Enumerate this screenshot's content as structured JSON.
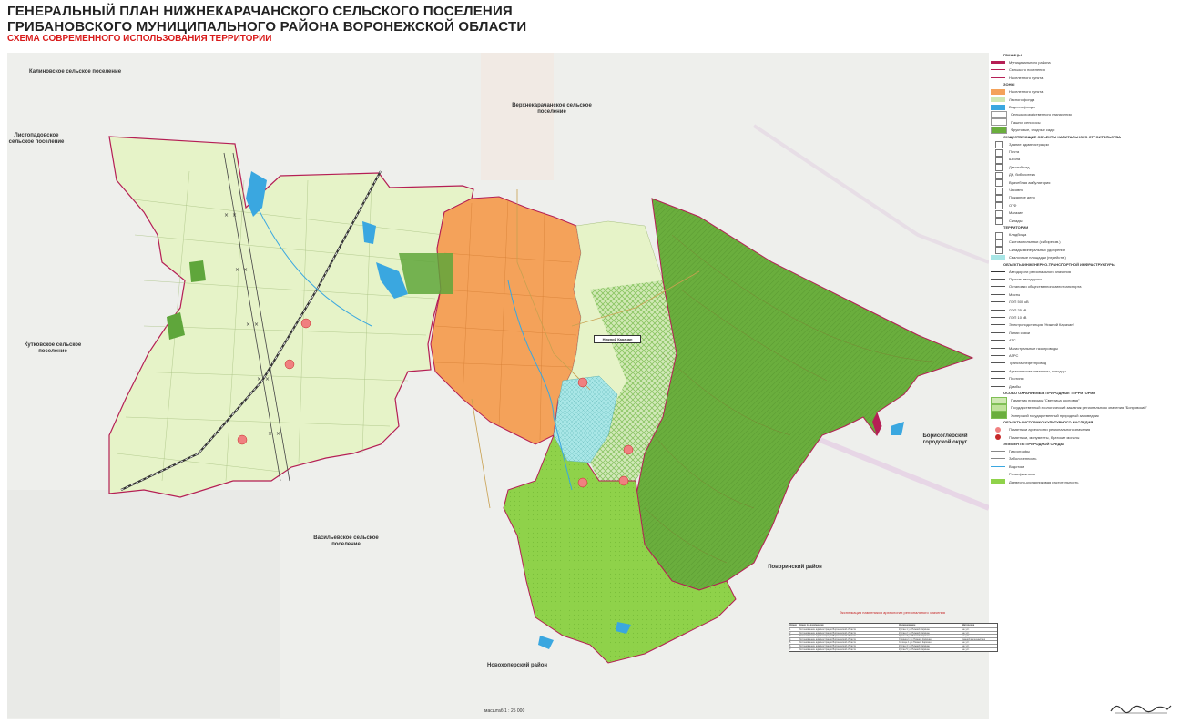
{
  "header": {
    "title_line1": "ГЕНЕРАЛЬНЫЙ ПЛАН НИЖНЕКАРАЧАНСКОГО СЕЛЬСКОГО ПОСЕЛЕНИЯ",
    "title_line2": "ГРИБАНОВСКОГО МУНИЦИПАЛЬНОГО РАЙОНА ВОРОНЕЖСКОЙ ОБЛАСТИ",
    "subtitle": "СХЕМА СОВРЕМЕННОГО ИСПОЛЬЗОВАНИЯ ТЕРРИТОРИИ"
  },
  "map": {
    "neighbors": {
      "kalinovskoe": "Калиновское сельское поселение",
      "listopadovskoe": "Листопадовское сельское поселение",
      "verkhnekarachanskoe": "Верхнекарачанское сельское поселение",
      "kutkovskoe": "Кутковское сельское поселение",
      "vasilevskoe": "Васильевское сельское поселение",
      "borisoglebskiy": "Борисоглебский городской округ",
      "povorinskiy": "Поворинский район",
      "novokhoperskiy": "Новохоперский район"
    },
    "settlement_label": "Нижний Карачан",
    "scale_text": "масштаб 1 : 25 000",
    "colors": {
      "agricultural": "#e6f3c8",
      "settlement": "#f4a25a",
      "forest_dark": "#6aae3d",
      "forest_light": "#8fd24a",
      "water": "#3aa7e0",
      "swamp": "#a8e6e6",
      "boundary": "#b51f55"
    }
  },
  "legend": {
    "sections": {
      "borders": "ГРАНИЦЫ",
      "zones": "ЗОНЫ",
      "capital": "СУЩЕСТВУЮЩИЕ ОБЪЕКТЫ КАПИТАЛЬНОГО СТРОИТЕЛЬСТВА",
      "territories": "ТЕРРИТОРИИ",
      "infra": "ОБЪЕКТЫ ИНЖЕНЕРНО-ТРАНСПОРТНОЙ ИНФРАСТРУКТУРЫ",
      "protected": "ОСОБО ОХРАНЯЕМЫЕ ПРИРОДНЫЕ ТЕРРИТОРИИ",
      "heritage": "ОБЪЕКТЫ ИСТОРИКО-КУЛЬТУРНОГО НАСЛЕДИЯ",
      "nature": "ЭЛЕМЕНТЫ ПРИРОДНОЙ СРЕДЫ"
    },
    "border_items": [
      "Муниципального района",
      "Сельского поселения",
      "Населенного пункта"
    ],
    "zone_items": [
      "Населенного пункта",
      "Лесного фонда",
      "Водного фонда",
      "Сельскохозяйственного назначения",
      "Пашни, сенокосы",
      "Фруктовые, ягодные сады"
    ],
    "capital_items": [
      "Здание администрации",
      "Почта",
      "Школа",
      "Детский сад",
      "ДК, библиотека",
      "Врачебная амбулатория",
      "Часовня",
      "Пожарное депо",
      "ОТФ",
      "Магазин",
      "Склады"
    ],
    "territory_items": [
      "Кладбища",
      "Скотомогильники (сибиреязв.)",
      "Склады минеральных удобрений",
      "Свалочные площадки (недейств.)"
    ],
    "infra_items": [
      "Автодороги регионального значения",
      "Прочие автодороги",
      "Остановки общественного автотранспорта",
      "Мосты",
      "ЛЭП 500 кВ",
      "ЛЭП 35 кВ",
      "ЛЭП 10 кВ",
      "Электроподстанция \"Нижний Карачан\"",
      "Линии связи",
      "АТС",
      "Магистральные газопроводы",
      "АГРС",
      "Трансгазнефтепровод",
      "Артезианские скважины, колодцы",
      "Плотины",
      "Дамбы"
    ],
    "protected_items": [
      "Памятник природы \"Светлица сосновая\"",
      "Государственный экологический заказник регионального значения \"Бопровский\"",
      "Хоперский государственный природный заповедник"
    ],
    "heritage_items": [
      "Памятники археологии регионального значения",
      "Памятники, монументы, братские могилы"
    ],
    "nature_items": [
      "Гидрографы",
      "Заболоченность",
      "Водотоки",
      "Рельеф/склоны",
      "Древесно-кустарниковая растительность"
    ]
  },
  "table": {
    "caption": "Экспликация памятников археологии регионального значения",
    "headers": [
      "Номер",
      "Номер по документам",
      "Наименование",
      "Датировка"
    ],
    "rows": [
      [
        "1",
        "Постановление администрации Воронежской области",
        "Курган 1 у с.Нижний Карачан",
        "не уст."
      ],
      [
        "2",
        "Постановление администрации Воронежской области",
        "Курган 2 у с.Нижний Карачан",
        "не уст."
      ],
      [
        "3",
        "Постановление администрации Воронежской области",
        "Курган 3 у с.Нижний Карачан",
        "не уст."
      ],
      [
        "4",
        "Постановление администрации Воронежской области",
        "Стоянка 1 у с.Нижний Карачан",
        "ранний железный век"
      ],
      [
        "5",
        "Постановление администрации Воронежской области",
        "Селище 1 у с.Нижний Карачан",
        "не уст."
      ],
      [
        "6",
        "Постановление администрации Воронежской области",
        "Курган 4 у с.Нижний Карачан",
        "не уст."
      ],
      [
        "7",
        "Постановление администрации Воронежской области",
        "Курган 5 у с.Нижний Карачан",
        "не уст."
      ]
    ]
  }
}
